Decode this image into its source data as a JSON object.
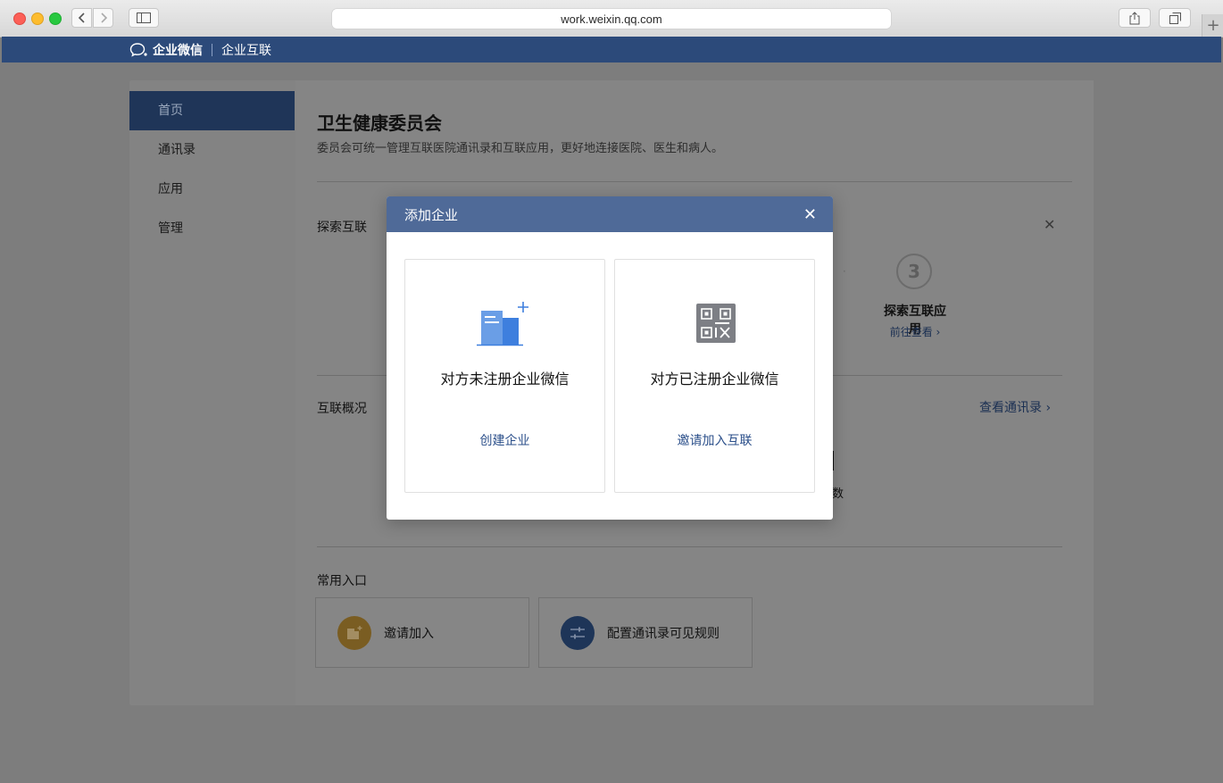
{
  "browser": {
    "url": "work.weixin.qq.com",
    "icons": [
      "back-chevron-icon",
      "forward-chevron-icon",
      "sidebar-icon",
      "share-icon",
      "tabs-icon",
      "plus-icon"
    ]
  },
  "header": {
    "brand": "企业微信",
    "section": "企业互联"
  },
  "sidebar": {
    "items": [
      {
        "label": "首页",
        "active": true
      },
      {
        "label": "通讯录",
        "active": false
      },
      {
        "label": "应用",
        "active": false
      },
      {
        "label": "管理",
        "active": false
      }
    ]
  },
  "main": {
    "title": "卫生健康委员会",
    "description": "委员会可统一管理互联医院通讯录和互联应用，更好地连接医院、医生和病人。",
    "explore": {
      "title": "探索互联",
      "close_glyph": "✕",
      "step_dot": "·",
      "step3_number": "3",
      "step3_title": "探索互联应用",
      "step3_link": "前往查看 ›"
    },
    "overview": {
      "title": "互联概况",
      "view_contacts": "查看通讯录 ›",
      "stat_fragment": "数"
    },
    "entries": {
      "title": "常用入口",
      "items": [
        {
          "label": "邀请加入",
          "icon": "invite-building-icon",
          "color": "#b5852a"
        },
        {
          "label": "配置通讯录可见规则",
          "icon": "sliders-icon",
          "color": "#2d4f86"
        }
      ]
    }
  },
  "modal": {
    "title": "添加企业",
    "close_glyph": "✕",
    "options": [
      {
        "title": "对方未注册企业微信",
        "link": "创建企业",
        "icon": "add-building-icon"
      },
      {
        "title": "对方已注册企业微信",
        "link": "邀请加入互联",
        "icon": "qr-code-icon"
      }
    ]
  },
  "colors": {
    "header_bg": "#2c4a7a",
    "modal_header_bg": "#4f6a98",
    "link": "#2b4f8a",
    "sidebar_active": "#1f3558"
  }
}
